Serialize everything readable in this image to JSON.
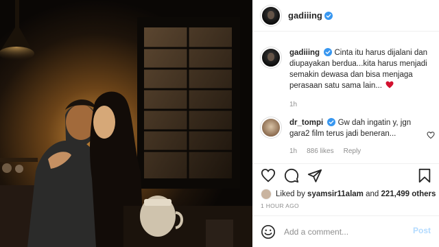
{
  "post": {
    "author": "gadiiing",
    "photo_alt": "photo"
  },
  "caption": {
    "username": "gadiiing",
    "text": "Cinta itu harus dijalani dan diupayakan berdua...kita harus menjadi semakin dewasa dan bisa menjaga perasaan satu sama lain...",
    "time": "1h"
  },
  "comments": [
    {
      "username": "dr_tompi",
      "text": "Gw dah ingatin y, jgn gara2 film terus jadi beneran...",
      "time": "1h",
      "likes": "886 likes",
      "reply": "Reply"
    }
  ],
  "likes": {
    "prefix": "Liked by",
    "user": "syamsir11alam",
    "conj": "and",
    "count": "221,499 others"
  },
  "time_ago": "1 HOUR AGO",
  "add_comment": {
    "placeholder": "Add a comment...",
    "post_label": "Post"
  },
  "colors": {
    "verified": "#3897f0",
    "heart": "#ed4956",
    "post_disabled": "#b3dbff"
  },
  "icons": [
    "verified-badge-icon",
    "heart-icon",
    "comment-icon",
    "share-icon",
    "bookmark-icon",
    "emoji-icon"
  ]
}
